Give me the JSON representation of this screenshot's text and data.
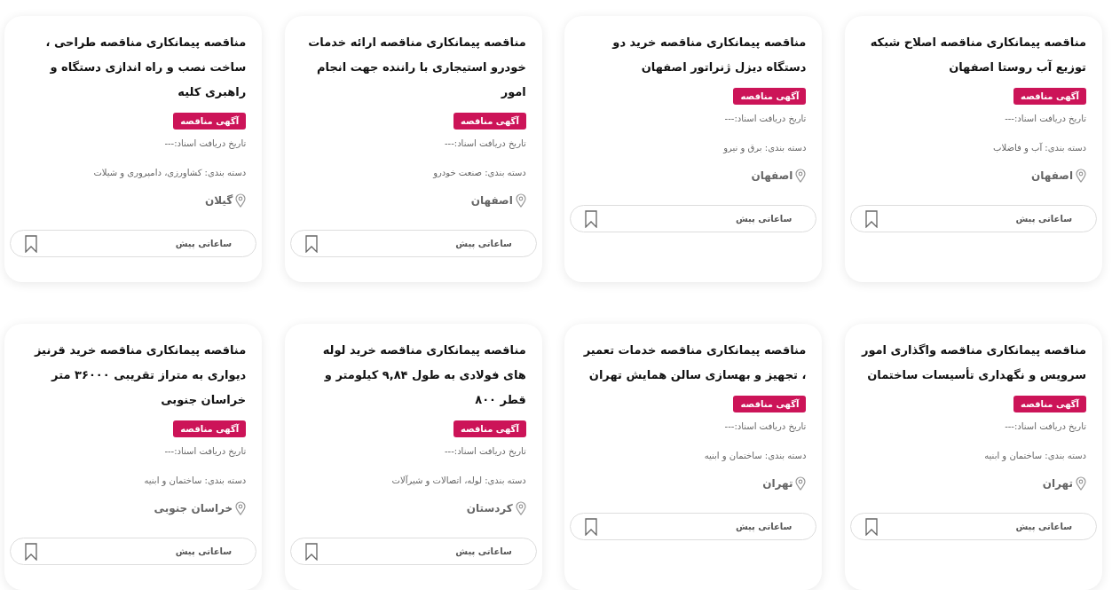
{
  "cards": [
    {
      "title": "مناقصه پیمانکاری مناقصه اصلاح شبکه توزیع آب روستا اصفهان",
      "badge": "آگهی مناقصه",
      "doc_date": "تاریخ دریافت اسناد:---",
      "category": "دسته بندی: آب و فاضلاب",
      "location": "اصفهان",
      "time": "ساعاتی پیش"
    },
    {
      "title": "مناقصه پیمانکاری مناقصه خرید دو دستگاه دیزل ژنراتور اصفهان",
      "badge": "آگهی مناقصه",
      "doc_date": "تاریخ دریافت اسناد:---",
      "category": "دسته بندی: برق و نیرو",
      "location": "اصفهان",
      "time": "ساعاتی پیش"
    },
    {
      "title": "مناقصه پیمانکاری مناقصه ارائه خدمات خودرو استیجاری با راننده جهت انجام امور",
      "badge": "آگهی مناقصه",
      "doc_date": "تاریخ دریافت اسناد:---",
      "category": "دسته بندی: صنعت خودرو",
      "location": "اصفهان",
      "time": "ساعاتی پیش"
    },
    {
      "title": "مناقصه پیمانکاری مناقصه طراحی ، ساخت نصب و راه اندازی دستگاه و راهبری کلیه",
      "badge": "آگهی مناقصه",
      "doc_date": "تاریخ دریافت اسناد:---",
      "category": "دسته بندی: کشاورزی، دامپروری و شیلات",
      "location": "گیلان",
      "time": "ساعاتی پیش"
    },
    {
      "title": "مناقصه پیمانکاری مناقصه واگذاری امور سرویس و نگهداری تأسیسات ساختمان",
      "badge": "آگهی مناقصه",
      "doc_date": "تاریخ دریافت اسناد:---",
      "category": "دسته بندی: ساختمان و ابنیه",
      "location": "تهران",
      "time": "ساعاتی پیش"
    },
    {
      "title": "مناقصه پیمانکاری مناقصه خدمات تعمیر ، تجهیز و بهسازی سالن همایش تهران",
      "badge": "آگهی مناقصه",
      "doc_date": "تاریخ دریافت اسناد:---",
      "category": "دسته بندی: ساختمان و ابنیه",
      "location": "تهران",
      "time": "ساعاتی پیش"
    },
    {
      "title": "مناقصه پیمانکاری مناقصه خرید لوله های فولادی به طول ۹,۸۴ کیلومتر و قطر ۸۰۰",
      "badge": "آگهی مناقصه",
      "doc_date": "تاریخ دریافت اسناد:---",
      "category": "دسته بندی: لوله، اتصالات و شیرآلات",
      "location": "کردستان",
      "time": "ساعاتی پیش"
    },
    {
      "title": "مناقصه پیمانکاری مناقصه خرید قرنیز دیواری به متراز تقریبی ۳۶۰۰۰ متر خراسان جنوبی",
      "badge": "آگهی مناقصه",
      "doc_date": "تاریخ دریافت اسناد:---",
      "category": "دسته بندی: ساختمان و ابنیه",
      "location": "خراسان جنوبی",
      "time": "ساعاتی پیش"
    }
  ]
}
